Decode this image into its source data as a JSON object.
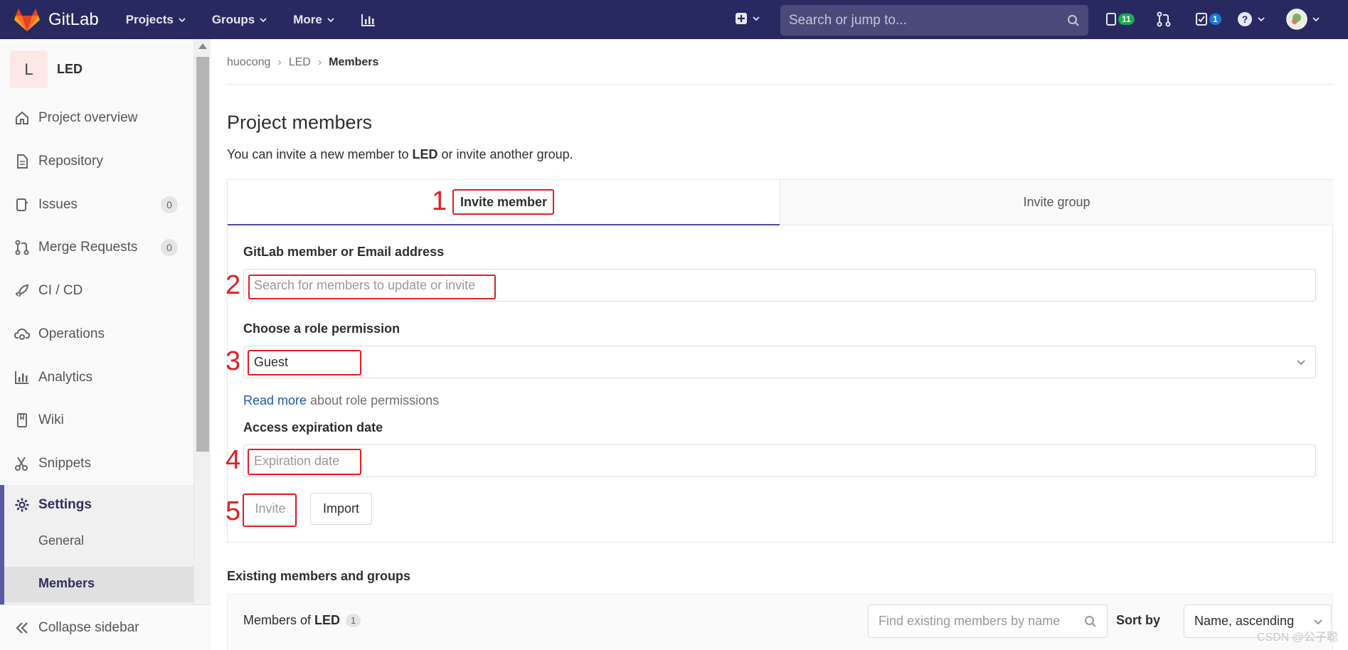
{
  "navbar": {
    "brand": "GitLab",
    "links": [
      "Projects",
      "Groups",
      "More"
    ],
    "search_placeholder": "Search or jump to...",
    "issues_count": "11",
    "todos_count": "1"
  },
  "sidebar": {
    "project_initial": "L",
    "project_name": "LED",
    "items": [
      {
        "label": "Project overview"
      },
      {
        "label": "Repository"
      },
      {
        "label": "Issues",
        "count": "0"
      },
      {
        "label": "Merge Requests",
        "count": "0"
      },
      {
        "label": "CI / CD"
      },
      {
        "label": "Operations"
      },
      {
        "label": "Analytics"
      },
      {
        "label": "Wiki"
      },
      {
        "label": "Snippets"
      }
    ],
    "settings_label": "Settings",
    "sub_items": [
      "General",
      "Members"
    ],
    "collapse_label": "Collapse sidebar"
  },
  "breadcrumb": [
    "huocong",
    "LED",
    "Members"
  ],
  "page": {
    "title": "Project members",
    "subtitle_prefix": "You can invite a new member to ",
    "subtitle_project": "LED",
    "subtitle_suffix": " or invite another group."
  },
  "invite": {
    "tab_member": "Invite member",
    "tab_group": "Invite group",
    "member_label": "GitLab member or Email address",
    "member_placeholder": "Search for members to update or invite",
    "role_label": "Choose a role permission",
    "role_value": "Guest",
    "read_more_link": "Read more",
    "read_more_text": " about role permissions",
    "expiration_label": "Access expiration date",
    "expiration_placeholder": "Expiration date",
    "invite_button": "Invite",
    "import_button": "Import"
  },
  "annotations": [
    "1",
    "2",
    "3",
    "4",
    "5"
  ],
  "existing": {
    "title": "Existing members and groups",
    "members_of": "Members of",
    "project": "LED",
    "count": "1",
    "find_placeholder": "Find existing members by name",
    "sort_label": "Sort by",
    "sort_value": "Name, ascending"
  },
  "watermark": "CSDN @公子聪",
  "colors": {
    "navbar": "#292961",
    "active_tab_border": "#4b4ba3",
    "annotation_red": "#e02020",
    "link_blue": "#1f5aa8"
  }
}
